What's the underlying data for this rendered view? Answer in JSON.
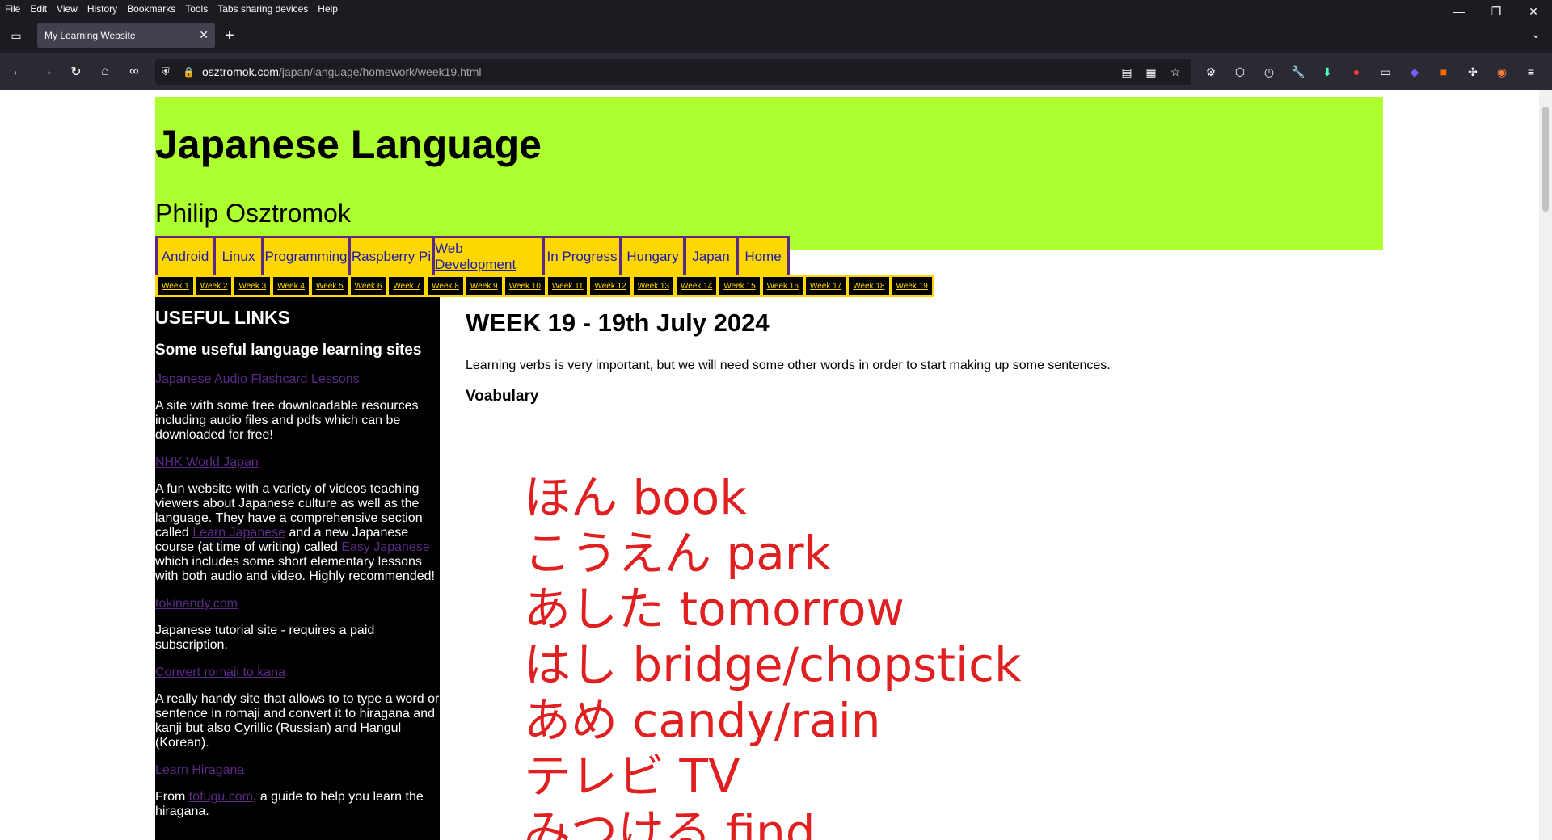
{
  "menubar": {
    "items": [
      "File",
      "Edit",
      "View",
      "History",
      "Bookmarks",
      "Tools",
      "Tabs sharing devices",
      "Help"
    ]
  },
  "tab": {
    "title": "My Learning Website"
  },
  "url": {
    "host": "osztromok.com",
    "path": "/japan/language/homework/week19.html"
  },
  "header": {
    "title": "Japanese Language",
    "author": "Philip Osztromok"
  },
  "mainnav": [
    {
      "label": "Android",
      "w": 90
    },
    {
      "label": "Linux",
      "w": 72
    },
    {
      "label": "Programming",
      "w": 130
    },
    {
      "label": "Raspberry Pi",
      "w": 128
    },
    {
      "label": "Web Development",
      "w": 166
    },
    {
      "label": "In Progress",
      "w": 118
    },
    {
      "label": "Hungary",
      "w": 96
    },
    {
      "label": "Japan",
      "w": 80
    },
    {
      "label": "Home",
      "w": 78
    }
  ],
  "weeknav": [
    "Week 1",
    "Week 2",
    "Week 3",
    "Week 4",
    "Week 5",
    "Week 6",
    "Week 7",
    "Week 8",
    "Week 9",
    "Week 10",
    "Week 11",
    "Week 12",
    "Week 13",
    "Week 14",
    "Week 15",
    "Week 16",
    "Week 17",
    "Week 18",
    "Week 19"
  ],
  "sidebar": {
    "heading": "USEFUL LINKS",
    "subheading": "Some useful language learning sites",
    "link1": "Japanese Audio Flashcard Lessons",
    "desc1": "A site with some free downloadable resources including audio files and pdfs which can be downloaded for free!",
    "link2": "NHK World Japan",
    "desc2_a": "A fun website with a variety of videos teaching viewers about Japanese culture as well as the language. They have a comprehensive section called ",
    "desc2_link1": "Learn Japanese",
    "desc2_b": " and a new Japanese course (at time of writing) called ",
    "desc2_link2": "Easy Japanese",
    "desc2_c": " which includes some short elementary lessons with both audio and video. Highly recommended!",
    "link3": "tokinandy.com",
    "desc3": "Japanese tutorial site - requires a paid subscription.",
    "link4": "Convert romaji to kana",
    "desc4": "A really handy site that allows to to type a word or sentence in romaji and convert it to hiragana and kanji but also Cyrillic (Russian) and Hangul (Korean).",
    "link5": "Learn Hiragana",
    "desc5_a": "From ",
    "desc5_link": "tofugu.com",
    "desc5_b": ", a guide to help you learn the hiragana."
  },
  "content": {
    "title": "WEEK 19 - 19th July 2024",
    "intro": "Learning verbs is very important, but we will need some other words in order to start making up some sentences.",
    "vocab_heading": "Voabulary",
    "vocab": [
      "ほん book",
      "こうえん park",
      "あした tomorrow",
      "はし bridge/chopstick",
      "あめ candy/rain",
      "テレビ TV",
      "みつける find"
    ]
  }
}
